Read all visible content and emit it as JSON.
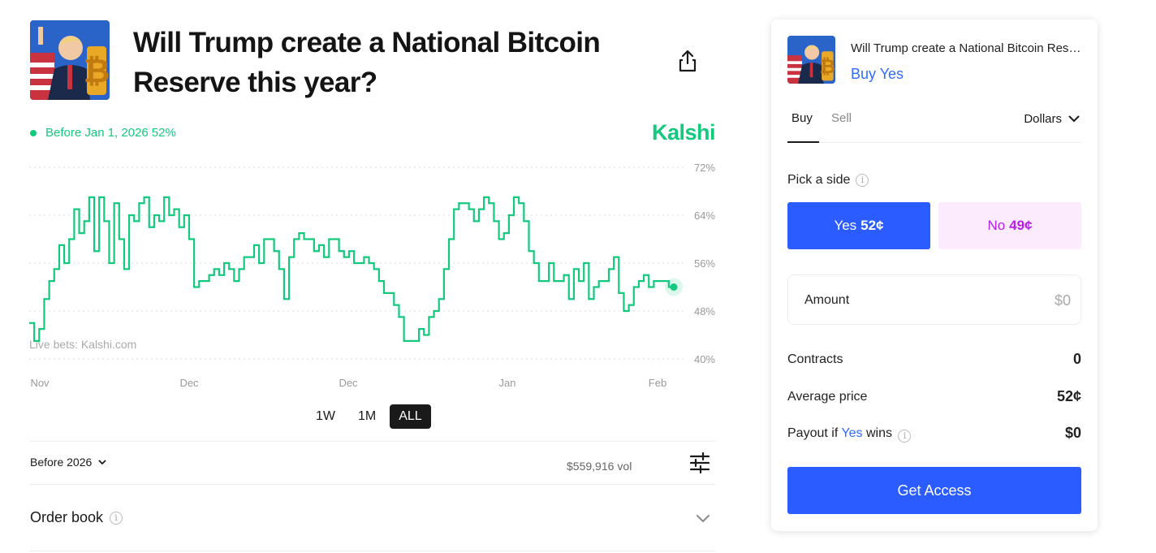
{
  "market": {
    "title": "Will Trump create a National Bitcoin Reserve this year?",
    "outcome_label": "Before Jan 1, 2026",
    "outcome_pct": "52%",
    "brand": "Kalshi",
    "watermark": "Live bets: Kalshi.com"
  },
  "chart_data": {
    "type": "line",
    "title": "",
    "x_labels": [
      "Nov",
      "Dec",
      "Dec",
      "Jan",
      "Feb"
    ],
    "y_ticks": [
      "72%",
      "64%",
      "56%",
      "48%",
      "40%"
    ],
    "ylim": [
      40,
      72
    ],
    "grid": "dotted horizontal",
    "series": [
      {
        "name": "Before Jan 1, 2026",
        "color": "#14c97e",
        "values": [
          46,
          43,
          45,
          50,
          53,
          55,
          59,
          56,
          60,
          65,
          61,
          63,
          67,
          58,
          67,
          63,
          56,
          66,
          60,
          55,
          64,
          63,
          66,
          67,
          62,
          64,
          63,
          67,
          64,
          65,
          62,
          64,
          60,
          52,
          53,
          53,
          54,
          55,
          54,
          56,
          55,
          53,
          55,
          57,
          57,
          59,
          56,
          60,
          60,
          58,
          55,
          50,
          57,
          60,
          61,
          60,
          60,
          58,
          59,
          57,
          60,
          60,
          58,
          57,
          58,
          56,
          56,
          57,
          56,
          55,
          53,
          51,
          51,
          49,
          47,
          43,
          43,
          43,
          45,
          44,
          47,
          48,
          50,
          55,
          60,
          65,
          66,
          66,
          65,
          63,
          65,
          67,
          66,
          63,
          60,
          61,
          64,
          67,
          66,
          63,
          58,
          56,
          53,
          53,
          56,
          53,
          53,
          54,
          50,
          55,
          53,
          56,
          50,
          52,
          53,
          53,
          55,
          57,
          51,
          48,
          49,
          52,
          53,
          54,
          52,
          53,
          53,
          53,
          52,
          52
        ]
      }
    ]
  },
  "ranges": [
    "1W",
    "1M",
    "ALL"
  ],
  "active_range": "ALL",
  "market_select": "Before 2026",
  "volume": {
    "amount": "$559,916",
    "unit": "vol"
  },
  "order_book": {
    "label": "Order book"
  },
  "order_panel": {
    "title": "Will Trump create a National Bitcoin Reserve this year?",
    "subtitle": "Buy Yes",
    "tabs": [
      "Buy",
      "Sell"
    ],
    "currency": "Dollars",
    "pick_label": "Pick a side",
    "yes": {
      "label": "Yes",
      "price": "52¢"
    },
    "no": {
      "label": "No",
      "price": "49¢"
    },
    "amount_label": "Amount",
    "amount_value": "$0",
    "contracts_label": "Contracts",
    "contracts_value": "0",
    "avg_label": "Average price",
    "avg_value": "52¢",
    "payout_prefix": "Payout if",
    "payout_yes": "Yes",
    "payout_suffix": "wins",
    "payout_value": "$0",
    "cta": "Get Access"
  },
  "colors": {
    "green": "#14c97e",
    "blue": "#2a5cff",
    "purple": "#b522e6"
  }
}
